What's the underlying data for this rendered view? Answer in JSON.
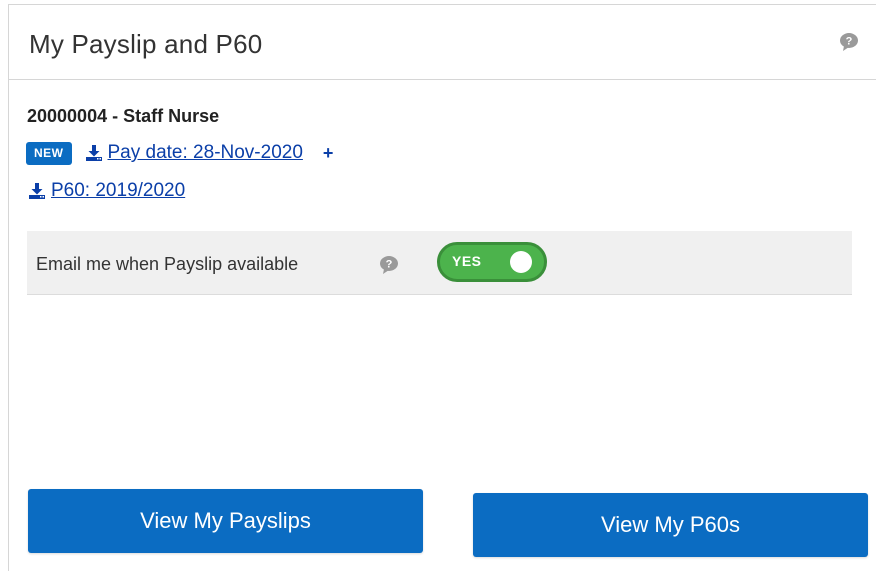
{
  "panel": {
    "title": "My Payslip and P60",
    "help_icon": "speech-bubble-help-icon"
  },
  "employee": {
    "line": "20000004 - Staff Nurse"
  },
  "payslip": {
    "badge": "NEW",
    "link_label": "Pay date: 28-Nov-2020",
    "expand_label": "+",
    "icon": "download-icon"
  },
  "p60": {
    "link_label": "P60: 2019/2020",
    "icon": "download-icon"
  },
  "email_pref": {
    "label": "Email me when Payslip available",
    "help_icon": "speech-bubble-help-icon",
    "toggle_label": "YES",
    "toggle_state": true
  },
  "buttons": {
    "view_payslips": "View My Payslips",
    "view_p60s": "View My P60s"
  },
  "colors": {
    "primary": "#0b6cc2",
    "link": "#0b3fa8",
    "toggle_on": "#4cb34c",
    "pref_background": "#f0f0f0"
  }
}
